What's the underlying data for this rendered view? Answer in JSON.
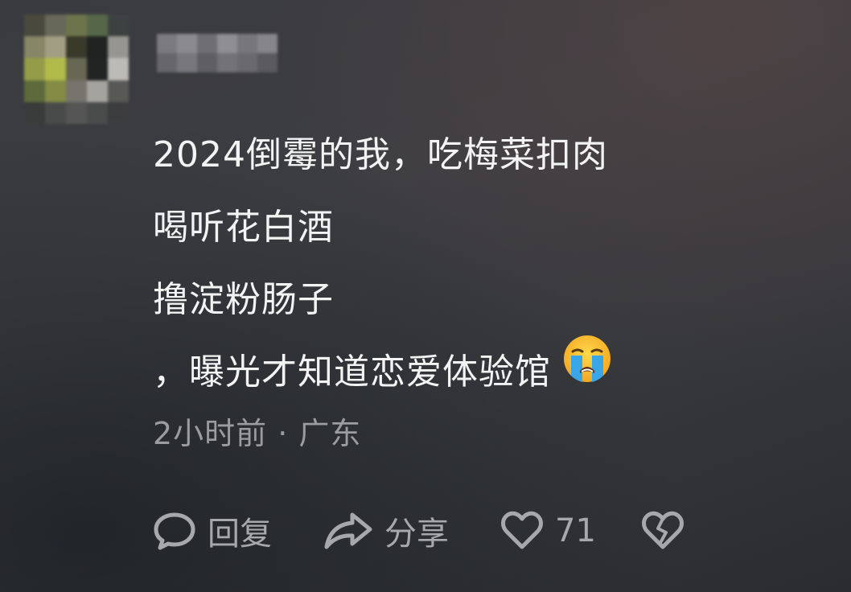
{
  "comment": {
    "lines": [
      "2024倒霉的我，吃梅菜扣肉",
      "喝听花白酒",
      "撸淀粉肠子",
      "，曝光才知道恋爱体验馆"
    ],
    "emoji": "loudly-crying-face"
  },
  "meta": {
    "text": "2小时前 · 广东"
  },
  "actions": {
    "reply_label": "回复",
    "share_label": "分享",
    "like_count": "71"
  },
  "icons": {
    "reply": "comment-bubble-icon",
    "share": "share-arrow-icon",
    "like": "heart-icon",
    "dislike": "broken-heart-icon"
  },
  "colors": {
    "text": "#f3f3f3",
    "muted": "#9a9ca2",
    "icon": "#a6a8ad"
  }
}
